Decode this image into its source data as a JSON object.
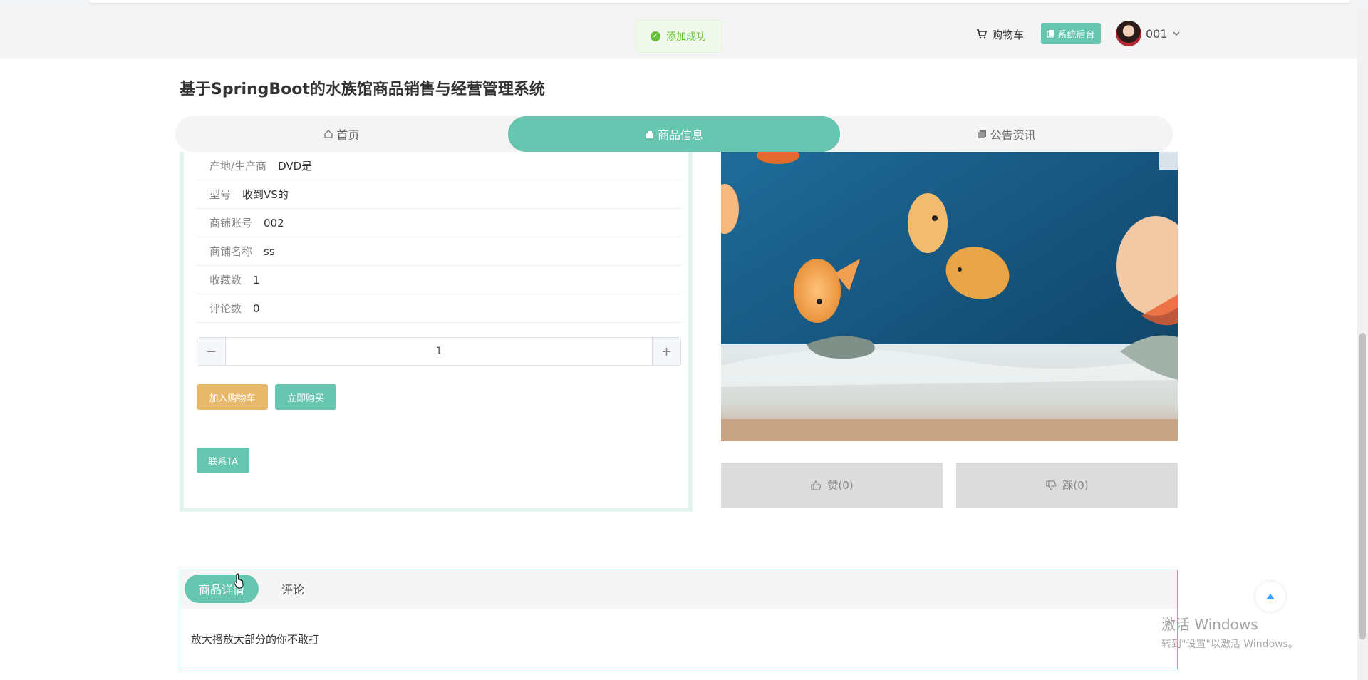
{
  "toast": {
    "message": "添加成功"
  },
  "header": {
    "cart_label": "购物车",
    "admin_label": "系统后台",
    "username": "001"
  },
  "site_title": "基于SpringBoot的水族馆商品销售与经营管理系统",
  "nav": {
    "items": [
      {
        "label": "首页",
        "icon": "home-icon"
      },
      {
        "label": "商品信息",
        "icon": "shop-icon"
      },
      {
        "label": "公告资讯",
        "icon": "news-icon"
      }
    ],
    "active_index": 1
  },
  "product": {
    "fields": [
      {
        "label": "产地/生产商",
        "value": "DVD是"
      },
      {
        "label": "型号",
        "value": "收到VS的"
      },
      {
        "label": "商铺账号",
        "value": "002"
      },
      {
        "label": "商铺名称",
        "value": "ss"
      },
      {
        "label": "收藏数",
        "value": "1"
      },
      {
        "label": "评论数",
        "value": "0"
      }
    ],
    "quantity": "1",
    "minus_symbol": "−",
    "plus_symbol": "+",
    "add_to_cart_label": "加入购物车",
    "buy_now_label": "立即购买",
    "contact_label": "联系TA",
    "like_label": "赞(0)",
    "dislike_label": "踩(0)"
  },
  "detail": {
    "tabs": [
      "商品详情",
      "评论"
    ],
    "active_tab": 0,
    "content": "放大播放大部分的你不敢打"
  },
  "watermark": {
    "title": "激活 Windows",
    "subtitle": "转到\"设置\"以激活 Windows。"
  },
  "colors": {
    "accent": "#66c6b0",
    "cart_button": "#e8b86a",
    "toast_success": "#67c23a"
  }
}
